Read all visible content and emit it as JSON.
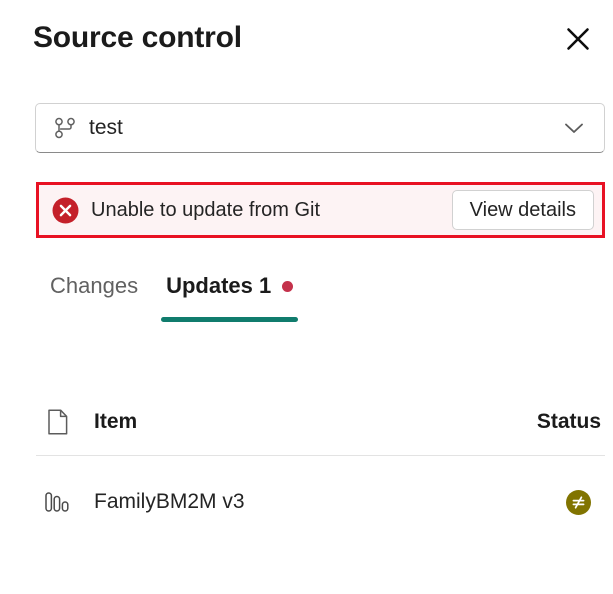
{
  "header": {
    "title": "Source control",
    "close_label": "Close",
    "close_icon": "close-icon"
  },
  "branch_selector": {
    "icon": "branch-icon",
    "value": "test",
    "chevron_icon": "chevron-down-icon",
    "options": [
      "test"
    ]
  },
  "error_banner": {
    "icon": "error-circle-icon",
    "message": "Unable to update from Git",
    "action_label": "View details",
    "border_color": "#e81123",
    "background_color": "#fdf3f4"
  },
  "tabs": [
    {
      "label": "Changes",
      "active": false,
      "has_dot": false
    },
    {
      "label": "Updates 1",
      "active": true,
      "has_dot": true
    }
  ],
  "tab_accent_color": "#107c6d",
  "tab_dot_color": "#c4314b",
  "table": {
    "header_icon": "document-icon",
    "columns": [
      "Item",
      "Status"
    ],
    "rows": [
      {
        "icon": "semantic-model-icon",
        "name": "FamilyBM2M v3",
        "status_icon": "not-equal-icon",
        "status_color": "#817400"
      }
    ]
  }
}
